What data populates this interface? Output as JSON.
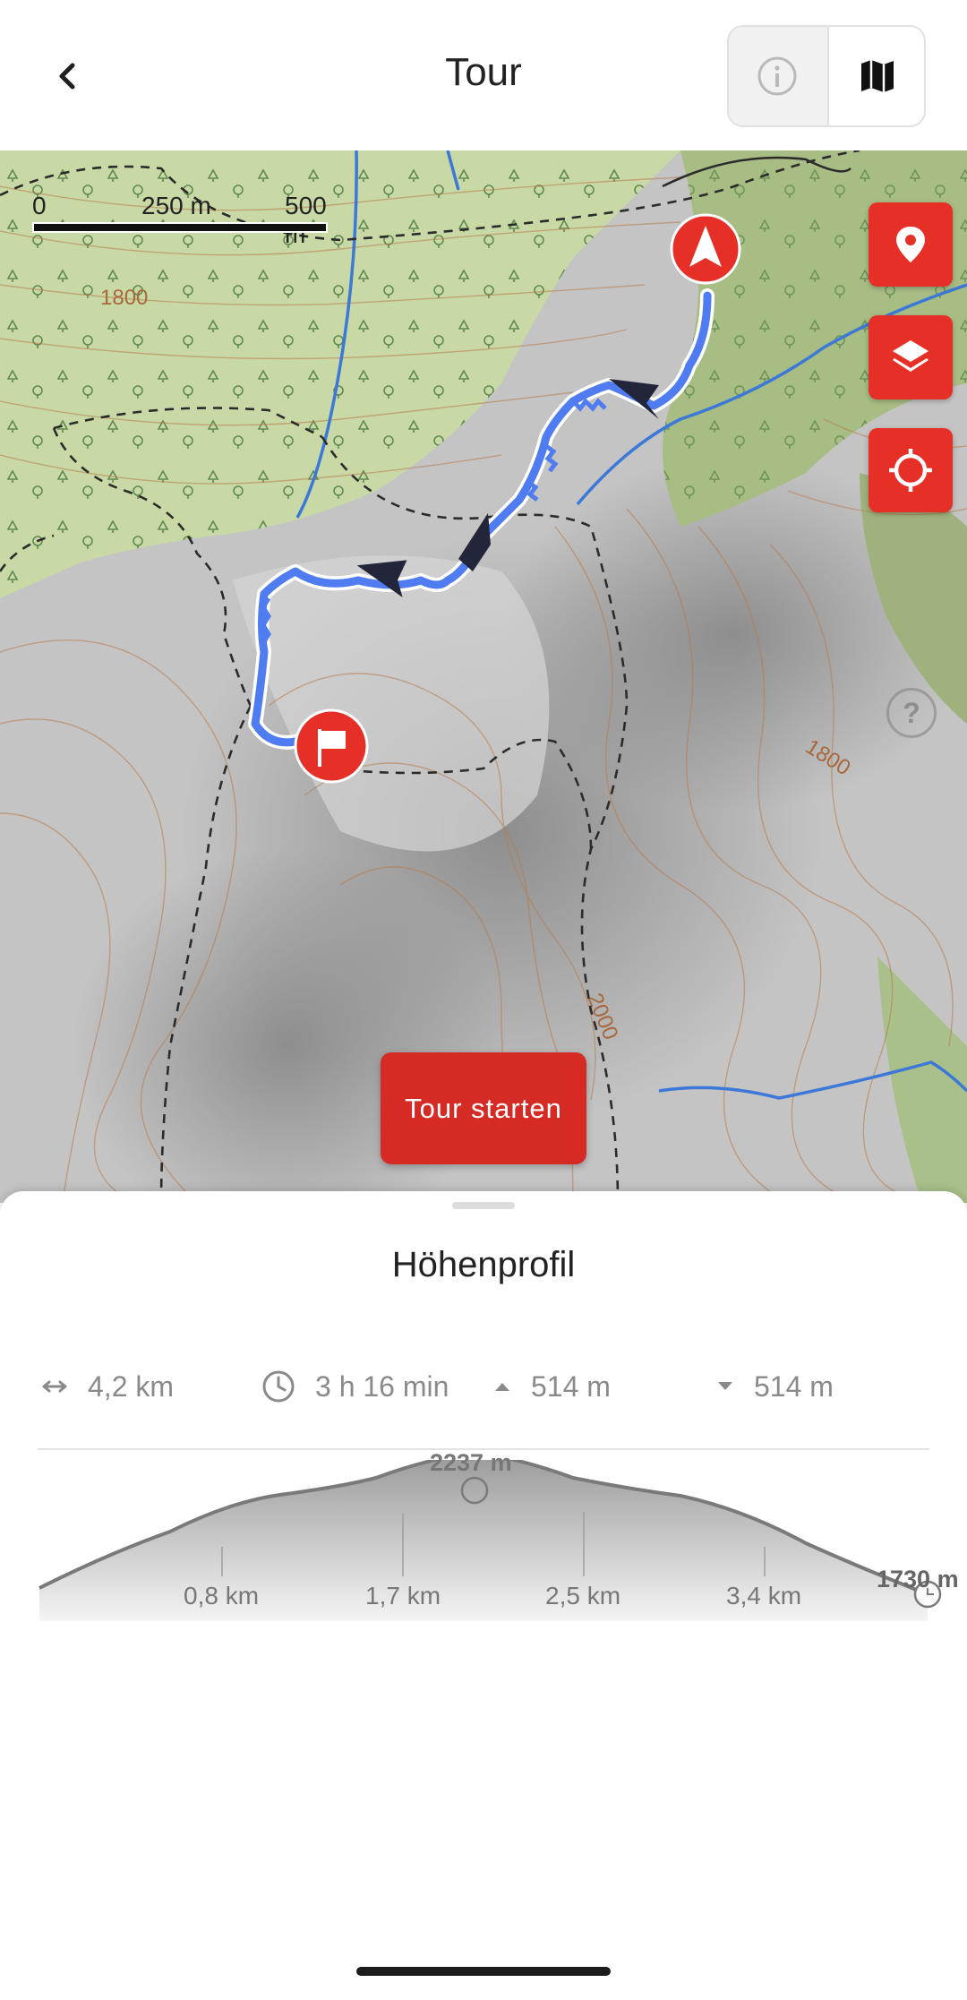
{
  "header": {
    "title": "Tour",
    "back_icon": "chevron-left-icon",
    "toggle": {
      "info_icon": "info-icon",
      "map_icon": "map-icon",
      "selected": "map"
    }
  },
  "map": {
    "scale": {
      "labels": [
        "0",
        "250 m",
        "500 m"
      ]
    },
    "contour_labels": [
      "1800",
      "1800",
      "2000"
    ],
    "buttons": [
      {
        "name": "poi-button",
        "icon": "location-pin-icon"
      },
      {
        "name": "layers-button",
        "icon": "layers-icon"
      },
      {
        "name": "locate-button",
        "icon": "crosshair-icon"
      }
    ],
    "help_glyph": "?",
    "start_button_label": "Tour starten",
    "colors": {
      "route": "#4f7cf0",
      "accent": "#e63027",
      "water": "#3b78d8"
    }
  },
  "sheet": {
    "title": "Höhenprofil",
    "stats": {
      "distance": "4,2 km",
      "duration": "3 h 16 min",
      "ascent": "514 m",
      "descent": "514 m"
    },
    "profile": {
      "max_label": "2237 m",
      "end_label": "1730 m",
      "ticks": [
        "0,8 km",
        "1,7 km",
        "2,5 km",
        "3,4 km"
      ]
    }
  }
}
